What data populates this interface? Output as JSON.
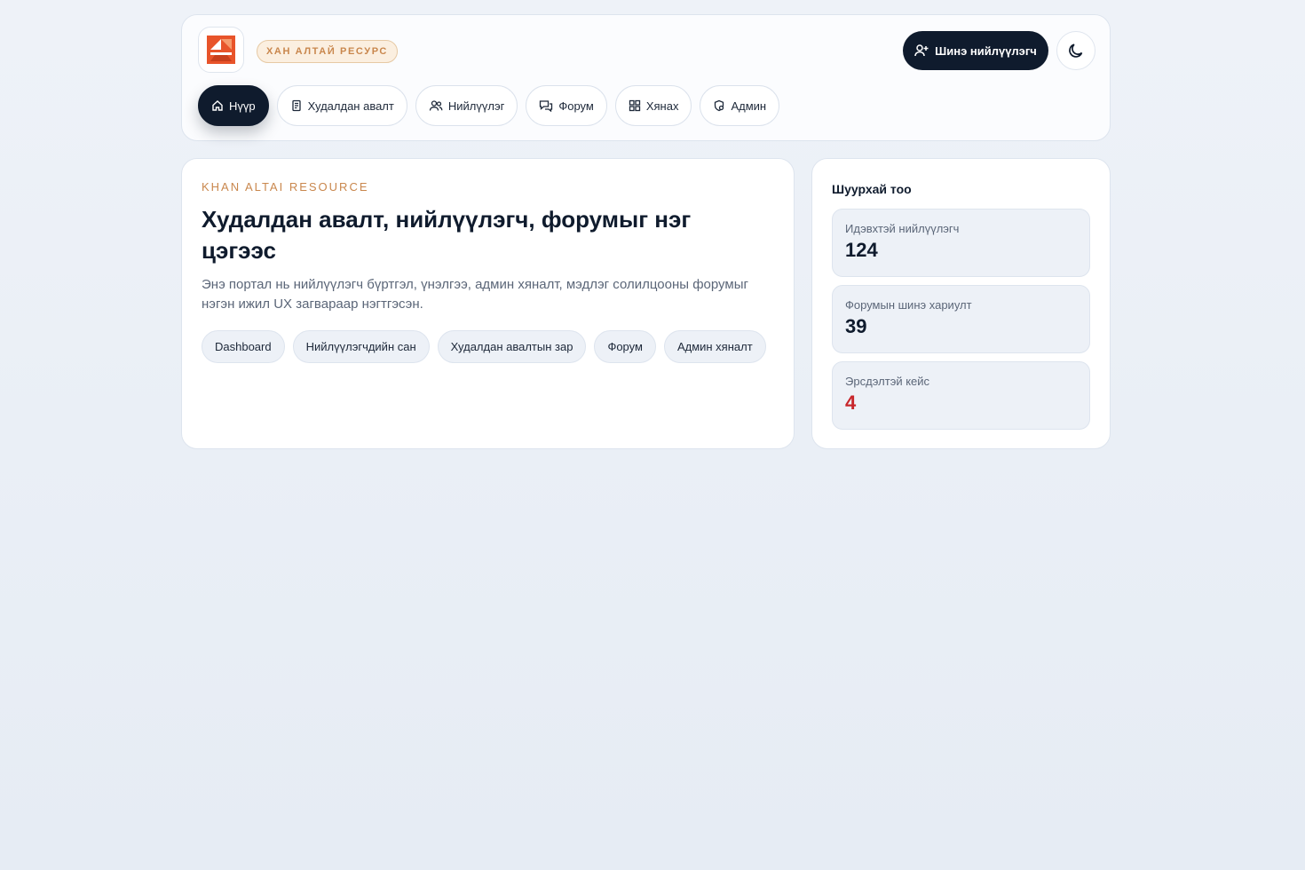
{
  "header": {
    "brand_badge": "ХАН АЛТАЙ РЕСУРС",
    "new_supplier_label": "Шинэ нийлүүлэгч",
    "nav": [
      {
        "label": "Нүүр",
        "icon": "home-icon",
        "active": true
      },
      {
        "label": "Худалдан авалт",
        "icon": "receipt-icon",
        "active": false
      },
      {
        "label": "Нийлүүлэг",
        "icon": "users-icon",
        "active": false
      },
      {
        "label": "Форум",
        "icon": "chat-icon",
        "active": false
      },
      {
        "label": "Хянах",
        "icon": "grid-icon",
        "active": false
      },
      {
        "label": "Админ",
        "icon": "shield-icon",
        "active": false
      }
    ]
  },
  "hero": {
    "kicker": "KHAN ALTAI RESOURCE",
    "title": "Худалдан авалт, нийлүүлэгч, форумыг нэг цэгээс",
    "description": "Энэ портал нь нийлүүлэгч бүртгэл, үнэлгээ, админ хяналт, мэдлэг солилцооны форумыг нэгэн ижил UX загвараар нэгтгэсэн.",
    "chips": [
      "Dashboard",
      "Нийлүүлэгчдийн сан",
      "Худалдан авалтын зар",
      "Форум",
      "Админ хяналт"
    ]
  },
  "stats": {
    "title": "Шуурхай тоо",
    "items": [
      {
        "label": "Идэвхтэй нийлүүлэгч",
        "value": "124",
        "status": "normal"
      },
      {
        "label": "Форумын шинэ хариулт",
        "value": "39",
        "status": "normal"
      },
      {
        "label": "Эрсдэлтэй кейс",
        "value": "4",
        "status": "danger"
      }
    ]
  },
  "colors": {
    "primary": "#0f1b2d",
    "accent": "#c9874d",
    "danger": "#c8262b",
    "logo_orange": "#e8542a"
  }
}
